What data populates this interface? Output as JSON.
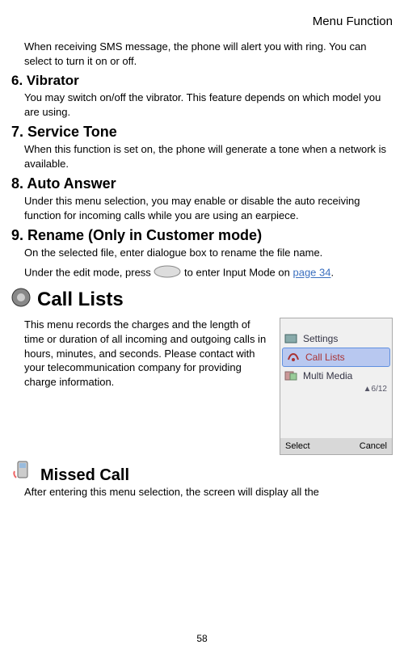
{
  "header": "Menu Function",
  "intro": "When receiving SMS message, the phone will alert you with ring. You can select to turn it on or off.",
  "sec6": {
    "title": "6. Vibrator",
    "body": "You may switch on/off the vibrator. This feature depends on which model you are using."
  },
  "sec7": {
    "title": "7. Service Tone",
    "body": "When this function is set on, the phone will generate a tone when a network is available."
  },
  "sec8": {
    "title": "8. Auto Answer",
    "body": "Under this menu selection, you may enable or disable the auto receiving function for incoming calls while you are using an earpiece."
  },
  "sec9": {
    "title": "9. Rename (Only in Customer mode)",
    "body1": "On the selected file, enter dialogue box to rename the file name.",
    "body2a": "Under the edit mode, press ",
    "body2b": " to enter Input Mode on ",
    "link": "page 34",
    "period": "."
  },
  "callLists": {
    "title": "Call Lists",
    "body": "This menu records the charges and the length of time or duration of all incoming and outgoing calls in hours, minutes, and seconds.    Please contact with your telecommunication company for providing charge information."
  },
  "phone": {
    "item1": "Settings",
    "item2": "Call Lists",
    "item3": "Multi Media",
    "counter": "6/12",
    "softLeft": "Select",
    "softRight": "Cancel"
  },
  "missed": {
    "title": "Missed Call",
    "body": "After entering this menu selection, the screen will display all the"
  },
  "pageNum": "58"
}
